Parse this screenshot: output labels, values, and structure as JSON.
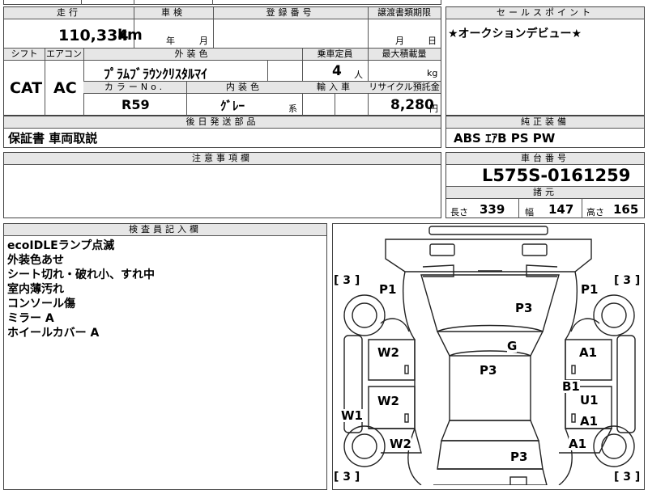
{
  "headers": {
    "mileage": "走行",
    "inspection": "車検",
    "registration": "登録番号",
    "transfer": "譲渡書類期限",
    "selling_points": "セールスポイント",
    "shift": "シフト",
    "aircon": "エアコン",
    "exterior_color": "外装色",
    "capacity": "乗車定員",
    "max_load": "最大積載量",
    "color_no": "カラーNo.",
    "interior_color": "内装色",
    "import": "輸入車",
    "recycle": "リサイクル預託金",
    "later_parts": "後日発送部品",
    "equipment": "純正装備",
    "notes": "注意事項欄",
    "chassis": "車台番号",
    "dimensions": "諸元",
    "inspector": "検査員記入欄"
  },
  "sheet": {
    "mileage_value": "110,334",
    "mileage_unit": "km",
    "inspection_year": "年",
    "inspection_month": "月",
    "transfer_month": "月",
    "transfer_day": "日",
    "selling_point": "★オークションデビュー★",
    "shift": "CAT",
    "aircon": "AC",
    "exterior_color": "ﾌﾟﾗﾑﾌﾞﾗｳﾝｸﾘｽﾀﾙﾏｲ",
    "capacity_value": "4",
    "capacity_unit": "人",
    "load_unit": "kg",
    "color_no": "R59",
    "interior_color": "ｸﾞﾚｰ",
    "interior_suffix": "系",
    "recycle_value": "8,280",
    "recycle_unit": "円",
    "later_parts": "保証書 車両取説",
    "equipment": "ABS ｴｱB PS PW",
    "chassis_no": "L575S-0161259",
    "length_label": "長さ",
    "length": "339",
    "width_label": "幅",
    "width": "147",
    "height_label": "高さ",
    "height": "165"
  },
  "inspector_notes": [
    "ecoIDLEランプ点滅",
    "外装色あせ",
    "シート切れ・破れ小、すれ中",
    "室内薄汚れ",
    "コンソール傷",
    "ミラー A",
    "ホイールカバー A"
  ],
  "diagram": {
    "tires": [
      "3",
      "3",
      "3",
      "3"
    ],
    "marks": {
      "p1_left": "P1",
      "p1_right": "P1",
      "p3_hood": "P3",
      "g": "G",
      "p3_roof": "P3",
      "w2_left_front": "W2",
      "a1_right_front": "A1",
      "b1": "B1",
      "w2_left_mid": "W2",
      "u1": "U1",
      "w1": "W1",
      "a1_right_mid": "A1",
      "w2_left_rear": "W2",
      "a1_right_rear": "A1",
      "p3_rear": "P3"
    }
  }
}
